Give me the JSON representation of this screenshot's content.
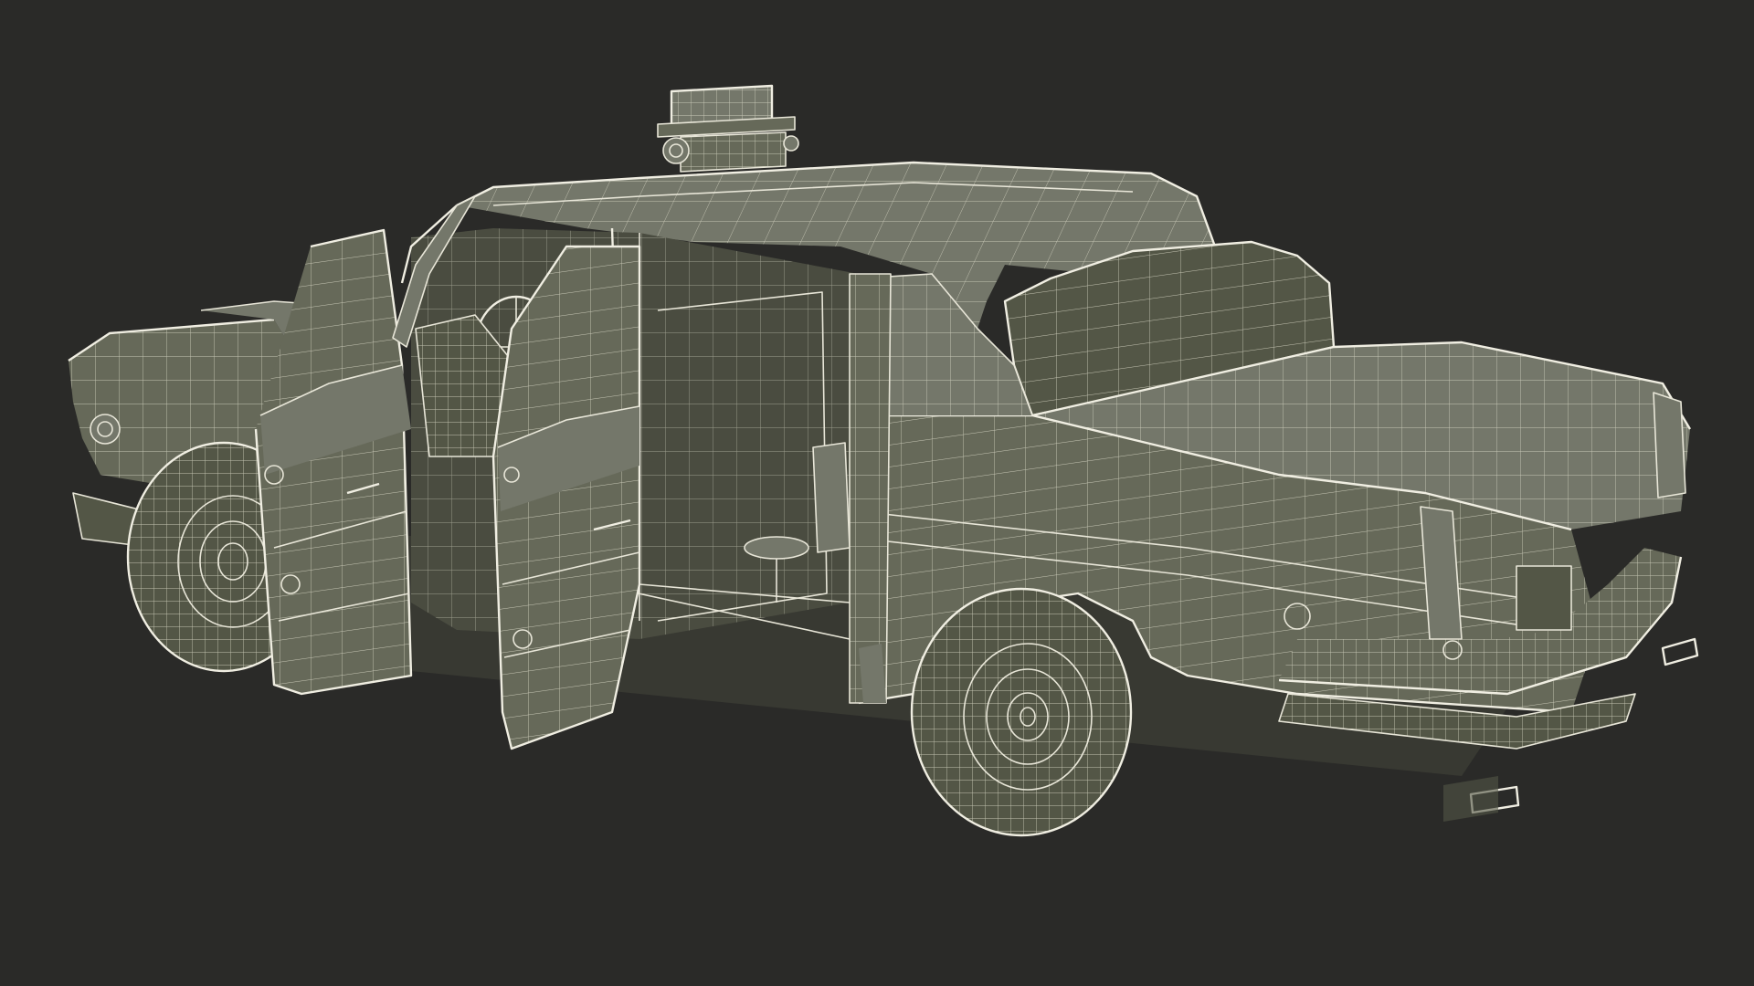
{
  "colors": {
    "background": "#2a2a28",
    "body": "#666959",
    "body_dark": "#535646",
    "body_light": "#74776a",
    "interior": "#4a4c40",
    "wire": "#e8e6d8"
  },
  "scene": {
    "subject": "wireframe-taxi-cab-3d-model",
    "view": "rear-three-quarter"
  }
}
